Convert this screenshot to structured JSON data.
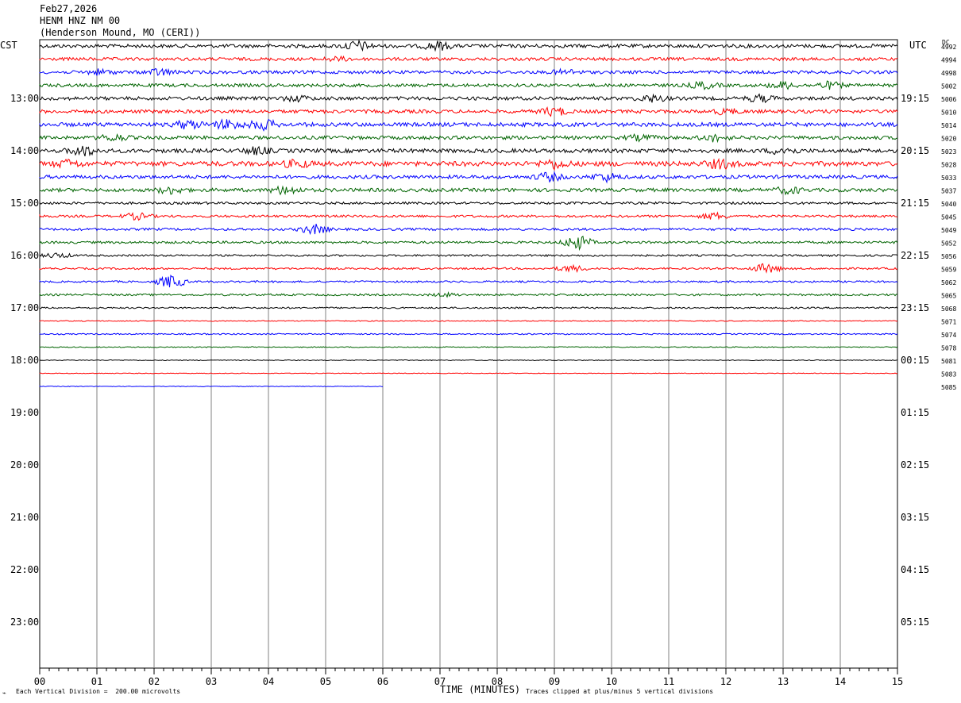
{
  "header": {
    "date": "Feb27,2026",
    "station": "HENM HNZ NM 00",
    "location": "(Henderson Mound, MO (CERI))"
  },
  "left_axis_label": "CST",
  "right_axis_label": "UTC",
  "dc_label": "DC",
  "footer": {
    "xlabel": "TIME (MINUTES)",
    "scale_note": "Each Vertical Division =  200.00 microvolts",
    "clip_note": "Traces clipped at plus/minus 5 vertical divisions"
  },
  "colors": {
    "black": "#000000",
    "red": "#ff0000",
    "blue": "#0000ff",
    "green": "#006400",
    "grid": "#808080"
  },
  "chart_data": {
    "type": "line",
    "title": "HENM HNZ NM 00",
    "xlabel": "TIME (MINUTES)",
    "x_range": [
      0,
      15
    ],
    "x_ticks": [
      "00",
      "01",
      "02",
      "03",
      "04",
      "05",
      "06",
      "07",
      "08",
      "09",
      "10",
      "11",
      "12",
      "13",
      "14",
      "15"
    ],
    "left_hour_labels": [
      "13:00",
      "14:00",
      "15:00",
      "16:00",
      "17:00",
      "18:00",
      "19:00",
      "20:00",
      "21:00",
      "22:00",
      "23:00"
    ],
    "right_hour_labels": [
      "19:15",
      "20:15",
      "21:15",
      "22:15",
      "23:15",
      "00:15",
      "01:15",
      "02:15",
      "03:15",
      "04:15",
      "05:15"
    ],
    "trace_colors": [
      "black",
      "red",
      "blue",
      "green"
    ],
    "dc_offsets": [
      "4992",
      "4994",
      "4998",
      "5002",
      "5006",
      "5010",
      "5014",
      "5020",
      "5023",
      "5028",
      "5033",
      "5037",
      "5040",
      "5045",
      "5049",
      "5052",
      "5056",
      "5059",
      "5062",
      "5065",
      "5068",
      "5071",
      "5074",
      "5078",
      "5081",
      "5083",
      "5085"
    ],
    "traces_count": 27,
    "last_trace_end_minute": 6
  }
}
